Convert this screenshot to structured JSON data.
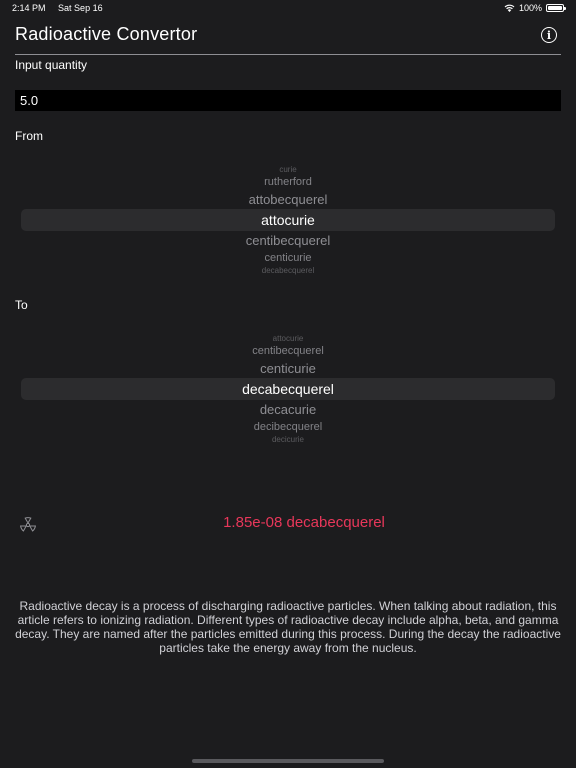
{
  "status": {
    "time": "2:14 PM",
    "date": "Sat Sep 16",
    "battery": "100%",
    "battery_level": 1.0
  },
  "header": {
    "title": "Radioactive Convertor",
    "info_icon": "info-icon"
  },
  "input": {
    "label": "Input quantity",
    "value": "5.0"
  },
  "from": {
    "label": "From",
    "items": [
      "curie",
      "rutherford",
      "attobecquerel",
      "attocurie",
      "centibecquerel",
      "centicurie",
      "decabecquerel"
    ],
    "selected": "attocurie"
  },
  "to": {
    "label": "To",
    "items": [
      "attocurie",
      "centibecquerel",
      "centicurie",
      "decabecquerel",
      "decacurie",
      "decibecquerel",
      "decicurie"
    ],
    "selected": "decabecquerel"
  },
  "result": {
    "text": "1.85e-08 decabecquerel",
    "icon": "radiation-icon",
    "color": "#e8375a"
  },
  "description": "Radioactive decay is a process of discharging radioactive particles. When talking about radiation, this article refers to ionizing radiation. Different types of radioactive decay include alpha, beta, and gamma decay. They are named after the particles emitted during this process. During the decay the radioactive particles take the energy away from the nucleus."
}
